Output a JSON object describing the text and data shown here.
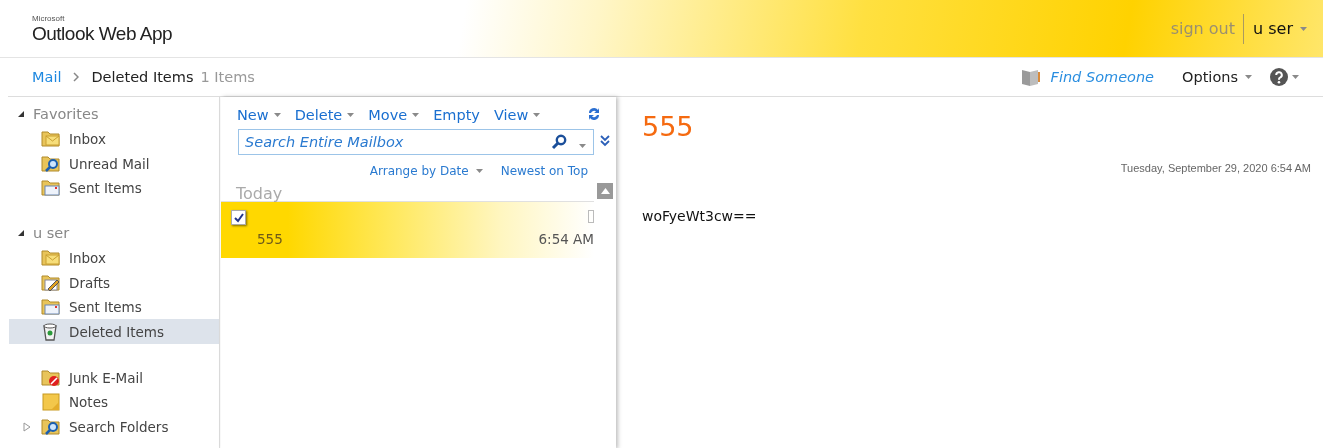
{
  "header": {
    "brand_small": "Microsoft",
    "brand": "Outlook Web App",
    "sign_out": "sign out",
    "user_menu": "u ser"
  },
  "breadcrumb": {
    "root": "Mail",
    "folder": "Deleted Items",
    "count": "1 Items"
  },
  "top_actions": {
    "find_someone": "Find Someone",
    "options": "Options"
  },
  "sidebar": {
    "sections": [
      {
        "label": "Favorites",
        "expanded": true,
        "groups": [
          {
            "items": [
              {
                "label": "Inbox",
                "kind": "inbox",
                "selected": false
              },
              {
                "label": "Unread Mail",
                "kind": "search",
                "selected": false
              },
              {
                "label": "Sent Items",
                "kind": "sent",
                "selected": false
              }
            ]
          }
        ]
      },
      {
        "label": "u ser",
        "expanded": true,
        "groups": [
          {
            "items": [
              {
                "label": "Inbox",
                "kind": "inbox",
                "selected": false
              },
              {
                "label": "Drafts",
                "kind": "drafts",
                "selected": false
              },
              {
                "label": "Sent Items",
                "kind": "sent",
                "selected": false
              },
              {
                "label": "Deleted Items",
                "kind": "deleted",
                "selected": true
              }
            ]
          },
          {
            "items": [
              {
                "label": "Junk E-Mail",
                "kind": "junk",
                "selected": false
              },
              {
                "label": "Notes",
                "kind": "notes",
                "selected": false
              },
              {
                "label": "Search Folders",
                "kind": "search",
                "selected": false,
                "expanded": false
              }
            ]
          }
        ]
      }
    ]
  },
  "toolbar": [
    {
      "label": "New",
      "menu": true
    },
    {
      "label": "Delete",
      "menu": true
    },
    {
      "label": "Move",
      "menu": true
    },
    {
      "label": "Empty",
      "menu": false
    },
    {
      "label": "View",
      "menu": true
    }
  ],
  "search": {
    "placeholder": "Search Entire Mailbox"
  },
  "sort": {
    "arrange": "Arrange by Date",
    "order": "Newest on Top"
  },
  "message_list": {
    "groups": [
      {
        "label": "Today",
        "messages": [
          {
            "subject": "555",
            "time": "6:54 AM",
            "checked": true,
            "selected": true
          }
        ]
      }
    ]
  },
  "reading_pane": {
    "subject": "555",
    "date": "Tuesday, September 29, 2020 6:54 AM",
    "body": "woFyeWt3cw=="
  }
}
